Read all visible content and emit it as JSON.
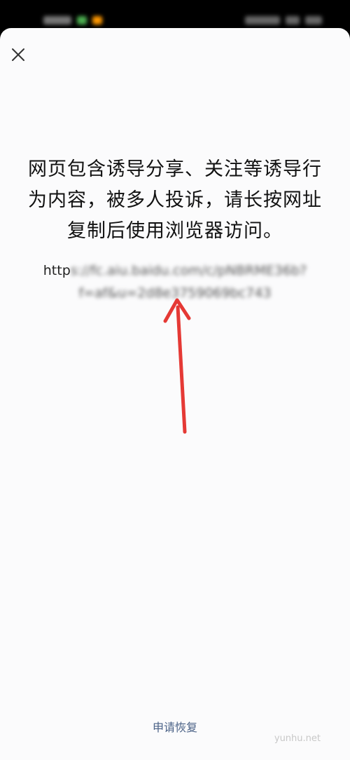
{
  "status_bar": {
    "blurred": true
  },
  "dialog": {
    "close_icon": "close-icon",
    "message": "网页包含诱导分享、关注等诱导行为内容，被多人投诉，请长按网址复制后使用浏览器访问。",
    "url_prefix": "http",
    "url_blurred": "s://fc.aiu.baidu.com/c/pNBRME36b?f=af&u=2d8e3759069bc743",
    "appeal_link": "申请恢复"
  },
  "watermark": "yunhu.net",
  "colors": {
    "sheet_bg": "#fbfbfc",
    "link": "#4a6186",
    "arrow": "#e53935"
  }
}
